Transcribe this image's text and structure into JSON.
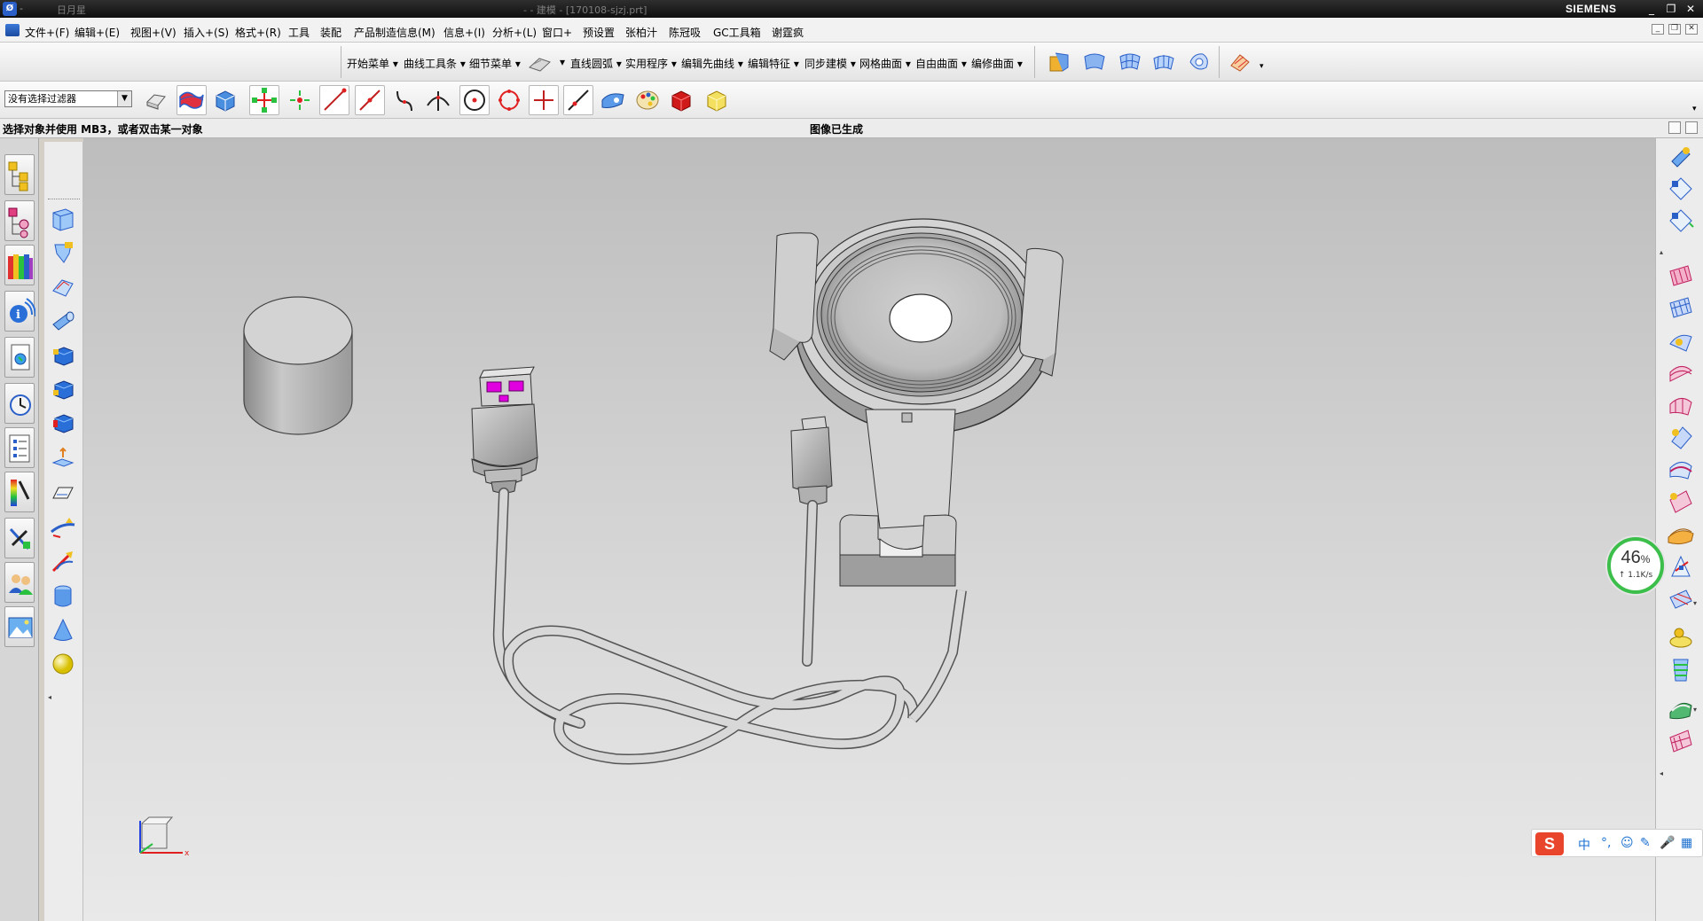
{
  "titlebar": {
    "left_text": "-",
    "user": "日月星",
    "center": "- - 建模 - [170108-sjzj.prt]",
    "brand": "SIEMENS",
    "buttons": [
      "_",
      "❐",
      "✕"
    ]
  },
  "menubar": {
    "items": [
      "文件+(F)",
      "编辑+(E)",
      "视图+(V)",
      "插入+(S)",
      "格式+(R)",
      "工具",
      "装配",
      "产品制造信息(M)",
      "信息+(I)",
      "分析+(L)",
      "窗口+",
      "预设置",
      "张柏汁",
      "陈冠吸",
      "GC工具箱",
      "谢霆疯"
    ],
    "mdi_buttons": [
      "_",
      "❐",
      "✕"
    ]
  },
  "toolbar1": {
    "labels": [
      "开始菜单 ▾",
      "曲线工具条 ▾",
      "细节菜单 ▾",
      "▾",
      "直线圆弧 ▾",
      "实用程序 ▾",
      "编辑先曲线 ▾",
      "编辑特征 ▾",
      "同步建模 ▾",
      "网格曲面 ▾",
      "自由曲面 ▾",
      "编修曲面 ▾"
    ]
  },
  "toolbar2": {
    "filter_value": "没有选择过滤器",
    "filter_arrow": "▼"
  },
  "statusbar": {
    "prompt": "选择对象并使用 MB3，或者双击某一对象",
    "message": "图像已生成"
  },
  "icons": {
    "resource_bar": [
      "assembly-navigator-icon",
      "part-navigator-icon",
      "reuse-library-icon",
      "web-browser-icon",
      "history-icon",
      "clock-icon",
      "system-materials-icon",
      "palette-icon",
      "tool-icon",
      "roles-icon",
      "image-icon"
    ],
    "feature_bar": [
      "extrude-icon",
      "revolve-icon",
      "sweep-icon",
      "tube-icon",
      "block-icon",
      "cylinder-face-icon",
      "box-icon",
      "offset-icon",
      "face-icon",
      "edge-blend-icon",
      "chamfer-icon",
      "cylinder-icon",
      "cone-icon",
      "sphere-icon"
    ],
    "right_bar": [
      "surface-1-icon",
      "surface-2-icon",
      "surface-3-icon",
      "surface-4-icon",
      "surface-5-icon",
      "surface-6-icon",
      "surface-7-icon",
      "surface-8-icon",
      "surface-9-icon",
      "surface-10-icon",
      "surface-11-icon",
      "surface-12-icon",
      "surface-13-icon",
      "surface-14-icon",
      "surface-15-icon",
      "surface-16-icon",
      "surface-17-icon",
      "surface-18-icon"
    ]
  },
  "speed_widget": {
    "percent": "46",
    "unit": "%",
    "rate": "↑ 1.1K/s"
  },
  "ime_bar": {
    "logo": "S",
    "lang": "中",
    "punct": "°,",
    "emoji": "☺",
    "pen": "✎",
    "mic": "🎤",
    "grid": "▦"
  },
  "axis_label": "x",
  "colors": {
    "accent": "#2a5fc8",
    "progress_ring": "#3bbf4a",
    "usb_pin": "#e000e0"
  }
}
